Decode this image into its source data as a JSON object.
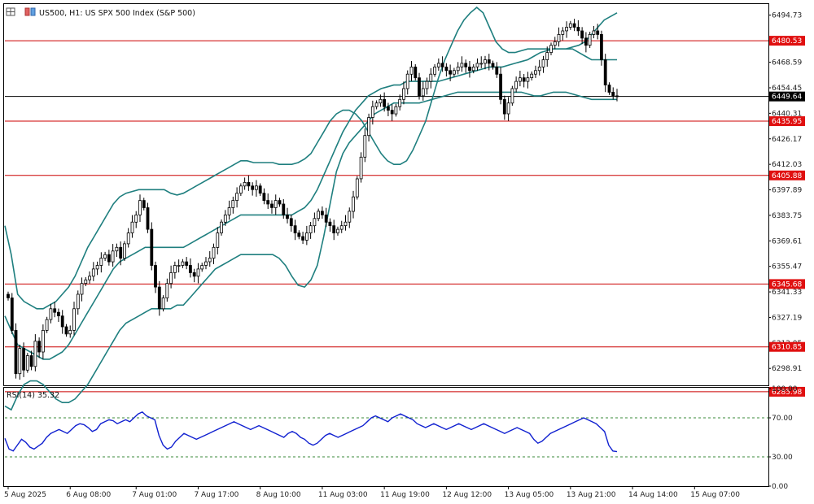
{
  "header": {
    "symbol_title": "US500, H1:  US SPX 500 Index (S&P 500)",
    "rsi_title": "RSI(14) 35.32"
  },
  "colors": {
    "bollinger": "#1f7f7f",
    "level_line": "#cc0000",
    "level_tag": "#e01010",
    "current_price_line": "#000000",
    "rsi_line": "#1020d0",
    "rsi_level": "#3a8a3a",
    "candle": "#000000"
  },
  "chart_data": [
    {
      "type": "candlestick",
      "title": "US500, H1:  US SPX 500 Index (S&P 500)",
      "ylim": [
        6290.0,
        6499.5
      ],
      "y_ticks": [
        6494.73,
        6468.59,
        6454.45,
        6440.31,
        6426.17,
        6412.03,
        6397.89,
        6383.75,
        6369.61,
        6355.47,
        6341.33,
        6327.19,
        6313.05,
        6298.91
      ],
      "y_tick_labels": [
        "6494.73",
        "6468.59",
        "6454.45",
        "6440.31",
        "6426.17",
        "6412.03",
        "6397.89",
        "6383.75",
        "6369.61",
        "6355.47",
        "6341.33",
        "6327.19",
        "6313.05",
        "6298.91"
      ],
      "x_tick_labels": [
        "5 Aug 2025",
        "6 Aug 08:00",
        "7 Aug 01:00",
        "7 Aug 17:00",
        "8 Aug 10:00",
        "11 Aug 03:00",
        "11 Aug 19:00",
        "12 Aug 12:00",
        "13 Aug 05:00",
        "13 Aug 21:00",
        "14 Aug 14:00",
        "15 Aug 07:00"
      ],
      "x_tick_bar_index": [
        0,
        16,
        33,
        49,
        65,
        81,
        97,
        113,
        129,
        145,
        161,
        177
      ],
      "horizontal_levels": [
        {
          "value": 6480.53,
          "label": "6480.53"
        },
        {
          "value": 6435.95,
          "label": "6435.95"
        },
        {
          "value": 6405.88,
          "label": "6405.88"
        },
        {
          "value": 6345.68,
          "label": "6345.68"
        },
        {
          "value": 6310.85,
          "label": "6310.85"
        },
        {
          "value": 6285.98,
          "label": "6285.98"
        }
      ],
      "current_price": {
        "value": 6449.64,
        "label": "6449.64"
      },
      "closes": [
        6338,
        6320,
        6296,
        6310,
        6298,
        6306,
        6300,
        6314,
        6308,
        6320,
        6326,
        6332,
        6330,
        6328,
        6322,
        6318,
        6320,
        6332,
        6340,
        6346,
        6348,
        6350,
        6354,
        6356,
        6360,
        6362,
        6358,
        6364,
        6366,
        6360,
        6368,
        6374,
        6380,
        6384,
        6392,
        6388,
        6376,
        6356,
        6344,
        6332,
        6338,
        6346,
        6352,
        6356,
        6356,
        6358,
        6356,
        6352,
        6350,
        6354,
        6356,
        6358,
        6360,
        6366,
        6374,
        6380,
        6384,
        6388,
        6392,
        6396,
        6400,
        6402,
        6400,
        6398,
        6400,
        6396,
        6392,
        6390,
        6388,
        6392,
        6390,
        6384,
        6382,
        6378,
        6374,
        6372,
        6370,
        6374,
        6378,
        6382,
        6386,
        6384,
        6380,
        6378,
        6374,
        6376,
        6378,
        6380,
        6386,
        6394,
        6404,
        6416,
        6428,
        6438,
        6444,
        6446,
        6448,
        6444,
        6442,
        6440,
        6444,
        6448,
        6454,
        6462,
        6466,
        6460,
        6450,
        6454,
        6458,
        6462,
        6466,
        6468,
        6466,
        6464,
        6462,
        6464,
        6466,
        6468,
        6466,
        6464,
        6466,
        6468,
        6468,
        6470,
        6468,
        6466,
        6462,
        6448,
        6440,
        6446,
        6454,
        6458,
        6460,
        6458,
        6460,
        6462,
        6464,
        6466,
        6470,
        6474,
        6478,
        6480,
        6484,
        6486,
        6488,
        6490,
        6488,
        6486,
        6482,
        6478,
        6484,
        6486,
        6484,
        6470,
        6456,
        6452,
        6450,
        6449.64
      ],
      "bb_upper": [
        6378,
        6362,
        6340,
        6336,
        6334,
        6332,
        6332,
        6334,
        6336,
        6340,
        6344,
        6350,
        6358,
        6366,
        6372,
        6378,
        6384,
        6390,
        6394,
        6396,
        6397,
        6398,
        6398,
        6398,
        6398,
        6398,
        6396,
        6395,
        6396,
        6398,
        6400,
        6402,
        6404,
        6406,
        6408,
        6410,
        6412,
        6414,
        6414,
        6413,
        6413,
        6413,
        6413,
        6412,
        6412,
        6412,
        6413,
        6415,
        6418,
        6424,
        6430,
        6436,
        6440,
        6442,
        6442,
        6440,
        6436,
        6430,
        6424,
        6418,
        6414,
        6412,
        6412,
        6414,
        6420,
        6428,
        6436,
        6448,
        6460,
        6470,
        6478,
        6486,
        6492,
        6496,
        6499,
        6496,
        6488,
        6480,
        6476,
        6474,
        6474,
        6475,
        6476,
        6476,
        6476,
        6476,
        6476,
        6476,
        6476,
        6477,
        6478,
        6480,
        6484,
        6488,
        6492,
        6494,
        6496
      ],
      "bb_middle": [
        6328,
        6320,
        6312,
        6310,
        6308,
        6306,
        6304,
        6304,
        6306,
        6308,
        6312,
        6318,
        6324,
        6330,
        6336,
        6342,
        6348,
        6354,
        6358,
        6360,
        6362,
        6364,
        6366,
        6366,
        6366,
        6366,
        6366,
        6366,
        6366,
        6368,
        6370,
        6372,
        6374,
        6376,
        6378,
        6380,
        6382,
        6384,
        6384,
        6384,
        6384,
        6384,
        6384,
        6384,
        6384,
        6384,
        6386,
        6388,
        6392,
        6398,
        6406,
        6414,
        6422,
        6430,
        6436,
        6442,
        6446,
        6450,
        6452,
        6454,
        6455,
        6456,
        6456,
        6458,
        6458,
        6458,
        6458,
        6458,
        6458,
        6459,
        6460,
        6461,
        6462,
        6463,
        6464,
        6465,
        6466,
        6466,
        6466,
        6467,
        6468,
        6469,
        6470,
        6472,
        6474,
        6475,
        6476,
        6476,
        6476,
        6476,
        6474,
        6472,
        6470,
        6470,
        6470,
        6470,
        6470
      ],
      "bb_lower": [
        6278,
        6276,
        6284,
        6290,
        6292,
        6292,
        6290,
        6286,
        6282,
        6280,
        6280,
        6282,
        6286,
        6290,
        6296,
        6302,
        6308,
        6314,
        6320,
        6324,
        6326,
        6328,
        6330,
        6332,
        6332,
        6332,
        6332,
        6334,
        6334,
        6338,
        6342,
        6346,
        6350,
        6354,
        6356,
        6358,
        6360,
        6362,
        6362,
        6362,
        6362,
        6362,
        6362,
        6360,
        6356,
        6350,
        6345,
        6344,
        6348,
        6356,
        6372,
        6390,
        6408,
        6418,
        6424,
        6428,
        6432,
        6436,
        6440,
        6442,
        6444,
        6446,
        6446,
        6446,
        6446,
        6446,
        6447,
        6448,
        6449,
        6450,
        6451,
        6452,
        6452,
        6452,
        6452,
        6452,
        6452,
        6452,
        6452,
        6452,
        6452,
        6452,
        6451,
        6450,
        6450,
        6451,
        6452,
        6452,
        6452,
        6451,
        6450,
        6449,
        6448,
        6448,
        6448,
        6448,
        6448
      ]
    },
    {
      "type": "line",
      "title": "RSI(14) 35.32",
      "ylim": [
        0,
        100
      ],
      "y_tick_labels": [
        "100.00",
        "70.00",
        "30.00",
        "0.00"
      ],
      "y_ticks": [
        100,
        70,
        30,
        0
      ],
      "levels": [
        70,
        30
      ],
      "current_value": 35.32,
      "values": [
        49,
        38,
        36,
        42,
        48,
        45,
        40,
        38,
        41,
        44,
        50,
        54,
        56,
        58,
        56,
        54,
        58,
        62,
        64,
        63,
        60,
        56,
        58,
        64,
        66,
        68,
        67,
        64,
        66,
        68,
        66,
        70,
        74,
        76,
        72,
        70,
        68,
        52,
        42,
        38,
        40,
        46,
        50,
        54,
        52,
        50,
        48,
        50,
        52,
        54,
        56,
        58,
        60,
        62,
        64,
        66,
        64,
        62,
        60,
        58,
        60,
        62,
        60,
        58,
        56,
        54,
        52,
        50,
        54,
        56,
        54,
        50,
        48,
        44,
        42,
        44,
        48,
        52,
        54,
        52,
        50,
        52,
        54,
        56,
        58,
        60,
        62,
        66,
        70,
        72,
        70,
        68,
        66,
        70,
        72,
        74,
        72,
        70,
        68,
        64,
        62,
        60,
        62,
        64,
        62,
        60,
        58,
        60,
        62,
        64,
        62,
        60,
        58,
        60,
        62,
        64,
        62,
        60,
        58,
        56,
        54,
        56,
        58,
        60,
        58,
        56,
        54,
        48,
        44,
        46,
        50,
        54,
        56,
        58,
        60,
        62,
        64,
        66,
        68,
        70,
        68,
        66,
        64,
        60,
        56,
        42,
        36,
        35.32
      ]
    }
  ]
}
